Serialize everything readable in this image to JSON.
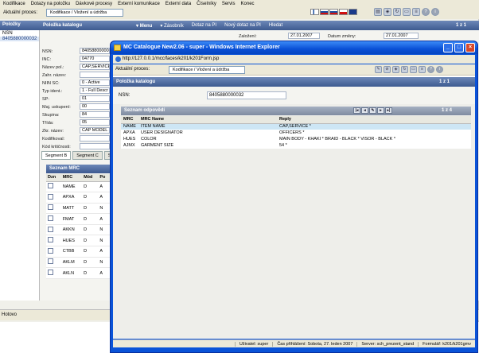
{
  "bg": {
    "menu": [
      "Kodifikace",
      "Dotazy na položku",
      "Dávkové procesy",
      "Externí komunikace",
      "Externí data",
      "Číselníky",
      "Servis",
      "Konec"
    ],
    "process_label": "Aktuální proces:",
    "process_value": "Kodifikace / Vložení a údržba",
    "left_header": "Položky",
    "left_nsn_header": "NSN",
    "left_nsn_value": "8405880000032",
    "main_header": {
      "title": "Položka katalogu",
      "menu": "Menu",
      "zasobnik": "Zásobník",
      "dotaz": "Dotaz na PI",
      "novy_dotaz": "Nový dotaz na PI",
      "hledat": "Hledat",
      "count": "1 z 1"
    },
    "zalozeni_label": "Založení:",
    "zalozeni_value": "27.01.2007",
    "datum_zmeny_label": "Datum změny:",
    "datum_zmeny_value": "27.01.2007",
    "fields": [
      {
        "label": "NSN:",
        "value": "8405880000032"
      },
      {
        "label": "INC:",
        "value": "04770"
      },
      {
        "label": "Název pol.:",
        "value": "CAP,SERVICE"
      },
      {
        "label": "Zahr. název:",
        "value": ""
      },
      {
        "label": "NIIN SC:",
        "value": "0 - Active"
      },
      {
        "label": "Typ ident.:",
        "value": "1 - Full Descr"
      },
      {
        "label": "SP:",
        "value": "01"
      },
      {
        "label": "Maj. uskupení:",
        "value": "00"
      },
      {
        "label": "Skupina:",
        "value": "84"
      },
      {
        "label": "Třída:",
        "value": "05"
      },
      {
        "label": "Zkr. název:",
        "value": "CAP MODEL 2"
      },
      {
        "label": "Kodifikoval:",
        "value": ""
      },
      {
        "label": "Kód kritičnosti:",
        "value": ""
      }
    ],
    "segment_tabs": [
      "Segment B",
      "Segment C",
      "Se"
    ],
    "mrc_header": "Seznam MRC",
    "mrc_cols": [
      "Dzn",
      "MRC",
      "Mód",
      "Po"
    ],
    "mrc_rows": [
      {
        "mrc": "NAME",
        "mod": "D",
        "po": "A"
      },
      {
        "mrc": "APXA",
        "mod": "D",
        "po": "A"
      },
      {
        "mrc": "MATT",
        "mod": "D",
        "po": "N"
      },
      {
        "mrc": "FMAT",
        "mod": "D",
        "po": "A"
      },
      {
        "mrc": "AKKN",
        "mod": "D",
        "po": "N"
      },
      {
        "mrc": "HUES",
        "mod": "D",
        "po": "N"
      },
      {
        "mrc": "CTBB",
        "mod": "D",
        "po": "A"
      },
      {
        "mrc": "AKLM",
        "mod": "D",
        "po": "N"
      },
      {
        "mrc": "AKLN",
        "mod": "D",
        "po": "A"
      }
    ],
    "status": "Hotovo"
  },
  "popup": {
    "title": "MC Catalogue New2.06 - super - Windows Internet Explorer",
    "url": "http://127.0.0.1/mcc/faces/k201/k201Form.jsp",
    "process_label": "Aktuální proces:",
    "process_value": "Kodifikace / Vložení a údržba",
    "header_title": "Položka katalogu",
    "header_count": "1 z 1",
    "nsn_label": "NSN:",
    "nsn_value": "8405880000032",
    "sub_header": "Seznam odpovědí",
    "sub_count": "1 z 4",
    "cols": [
      "MRC",
      "MRC Name",
      "Reply"
    ],
    "rows": [
      {
        "mrc": "NAME",
        "name": "ITEM NAME",
        "reply": "CAP,SERVICE *"
      },
      {
        "mrc": "APXA",
        "name": "USER DESIGNATOR",
        "reply": "OFFICERS *"
      },
      {
        "mrc": "HUES",
        "name": "COLOR",
        "reply": "MAIN BODY - KHAKI * BRAID - BLACK * VISOR - BLACK *"
      },
      {
        "mrc": "AJMX",
        "name": "GARMENT SIZE",
        "reply": "54 *"
      }
    ],
    "status": {
      "user": "Uživatel: super",
      "login": "Čas přihlášení: Sobota, 27. leden 2007",
      "server": "Server: sch_prezent_stand",
      "form": "Formulář: k201/k201gmv"
    }
  }
}
